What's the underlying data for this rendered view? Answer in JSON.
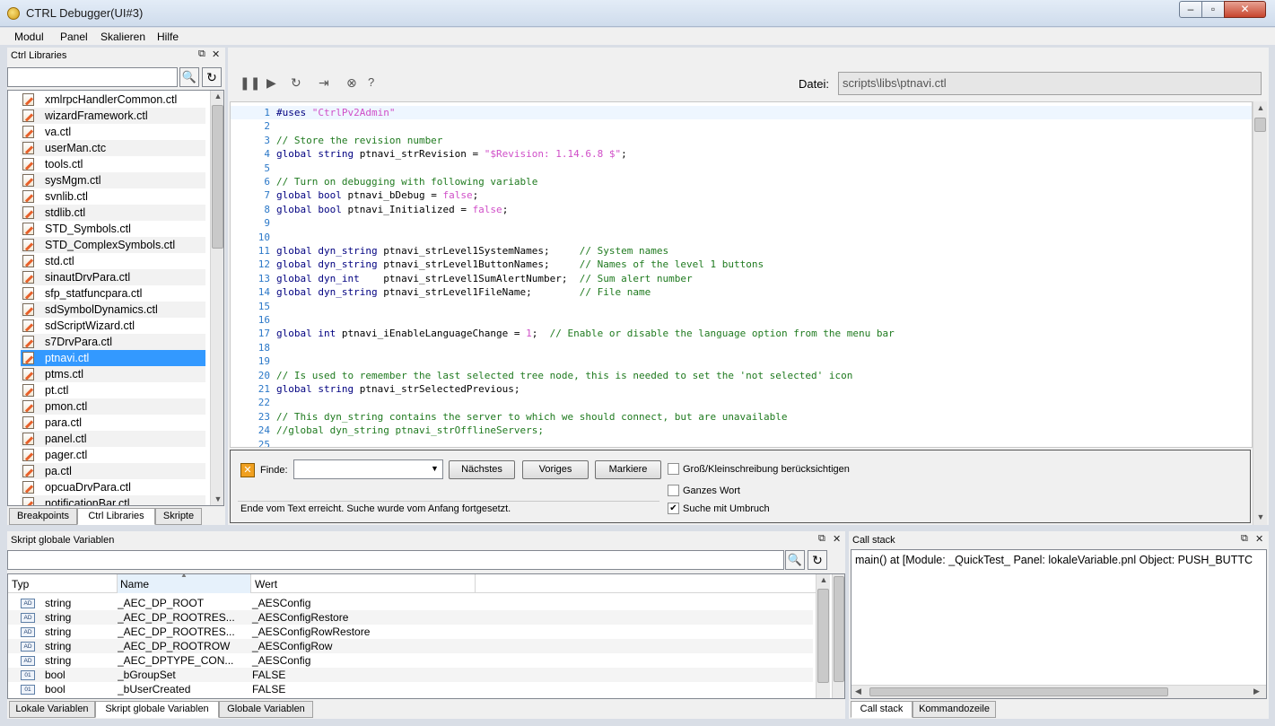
{
  "window": {
    "title": "CTRL Debugger(UI#3)",
    "min": "–",
    "max": "▫",
    "close": "✕"
  },
  "menu": [
    "Modul",
    "Panel",
    "Skalieren",
    "Hilfe"
  ],
  "libs_panel": {
    "title": "Ctrl Libraries",
    "search_placeholder": "",
    "items": [
      "xmlrpcHandlerCommon.ctl",
      "wizardFramework.ctl",
      "va.ctl",
      "userMan.ctc",
      "tools.ctl",
      "sysMgm.ctl",
      "svnlib.ctl",
      "stdlib.ctl",
      "STD_Symbols.ctl",
      "STD_ComplexSymbols.ctl",
      "std.ctl",
      "sinautDrvPara.ctl",
      "sfp_statfuncpara.ctl",
      "sdSymbolDynamics.ctl",
      "sdScriptWizard.ctl",
      "s7DrvPara.ctl",
      "ptnavi.ctl",
      "ptms.ctl",
      "pt.ctl",
      "pmon.ctl",
      "para.ctl",
      "panel.ctl",
      "pager.ctl",
      "pa.ctl",
      "opcuaDrvPara.ctl",
      "notificationBar.ctl"
    ],
    "selected_index": 16,
    "tabs": [
      "Breakpoints",
      "Ctrl Libraries",
      "Skripte"
    ],
    "active_tab": 1
  },
  "toolbar": {
    "file_label": "Datei:",
    "file_path": "scripts\\libs\\ptnavi.ctl",
    "help": "?"
  },
  "code": [
    {
      "n": "1",
      "t": [
        [
          "kw",
          "#uses "
        ],
        [
          "str",
          "\"CtrlPv2Admin\""
        ]
      ]
    },
    {
      "n": "2",
      "t": []
    },
    {
      "n": "3",
      "t": [
        [
          "cmt",
          "// Store the revision number"
        ]
      ]
    },
    {
      "n": "4",
      "t": [
        [
          "kw",
          "global string "
        ],
        [
          "",
          "ptnavi_strRevision = "
        ],
        [
          "str",
          "\"$Revision: 1.14.6.8 $\""
        ],
        [
          "",
          ";"
        ]
      ]
    },
    {
      "n": "5",
      "t": []
    },
    {
      "n": "6",
      "t": [
        [
          "cmt",
          "// Turn on debugging with following variable"
        ]
      ]
    },
    {
      "n": "7",
      "t": [
        [
          "kw",
          "global bool "
        ],
        [
          "",
          "ptnavi_bDebug = "
        ],
        [
          "fls",
          "false"
        ],
        [
          "",
          ";"
        ]
      ]
    },
    {
      "n": "8",
      "t": [
        [
          "kw",
          "global bool "
        ],
        [
          "",
          "ptnavi_Initialized = "
        ],
        [
          "fls",
          "false"
        ],
        [
          "",
          ";"
        ]
      ]
    },
    {
      "n": "9",
      "t": []
    },
    {
      "n": "10",
      "t": []
    },
    {
      "n": "11",
      "t": [
        [
          "kw",
          "global dyn_string "
        ],
        [
          "",
          "ptnavi_strLevel1SystemNames;     "
        ],
        [
          "cmt",
          "// System names"
        ]
      ]
    },
    {
      "n": "12",
      "t": [
        [
          "kw",
          "global dyn_string "
        ],
        [
          "",
          "ptnavi_strLevel1ButtonNames;     "
        ],
        [
          "cmt",
          "// Names of the level 1 buttons"
        ]
      ]
    },
    {
      "n": "13",
      "t": [
        [
          "kw",
          "global dyn_int    "
        ],
        [
          "",
          "ptnavi_strLevel1SumAlertNumber;  "
        ],
        [
          "cmt",
          "// Sum alert number"
        ]
      ]
    },
    {
      "n": "14",
      "t": [
        [
          "kw",
          "global dyn_string "
        ],
        [
          "",
          "ptnavi_strLevel1FileName;        "
        ],
        [
          "cmt",
          "// File name"
        ]
      ]
    },
    {
      "n": "15",
      "t": []
    },
    {
      "n": "16",
      "t": []
    },
    {
      "n": "17",
      "t": [
        [
          "kw",
          "global int "
        ],
        [
          "",
          "ptnavi_iEnableLanguageChange = "
        ],
        [
          "str",
          "1"
        ],
        [
          "",
          ";  "
        ],
        [
          "cmt",
          "// Enable or disable the language option from the menu bar"
        ]
      ]
    },
    {
      "n": "18",
      "t": []
    },
    {
      "n": "19",
      "t": []
    },
    {
      "n": "20",
      "t": [
        [
          "cmt",
          "// Is used to remember the last selected tree node, this is needed to set the 'not selected' icon"
        ]
      ]
    },
    {
      "n": "21",
      "t": [
        [
          "kw",
          "global string "
        ],
        [
          "",
          "ptnavi_strSelectedPrevious;"
        ]
      ]
    },
    {
      "n": "22",
      "t": []
    },
    {
      "n": "23",
      "t": [
        [
          "cmt",
          "// This dyn_string contains the server to which we should connect, but are unavailable"
        ]
      ]
    },
    {
      "n": "24",
      "t": [
        [
          "cmt",
          "//global dyn_string ptnavi_strOfflineServers;"
        ]
      ]
    },
    {
      "n": "25",
      "t": []
    }
  ],
  "find": {
    "label": "Finde:",
    "value": "",
    "next": "Nächstes",
    "prev": "Voriges",
    "mark": "Markiere",
    "case": "Groß/Kleinschreibung berücksichtigen",
    "whole": "Ganzes Wort",
    "wrap": "Suche mit Umbruch",
    "case_checked": false,
    "whole_checked": false,
    "wrap_checked": true,
    "status": "Ende vom Text erreicht. Suche wurde vom Anfang fortgesetzt."
  },
  "globals_panel": {
    "title": "Skript globale Variablen",
    "columns": [
      "Typ",
      "Name",
      "Wert"
    ],
    "rows": [
      {
        "icon": "AD",
        "type": "string",
        "name": "_AEC_DP_ROOT",
        "value": "_AESConfig"
      },
      {
        "icon": "AD",
        "type": "string",
        "name": "_AEC_DP_ROOTRES...",
        "value": "_AESConfigRestore"
      },
      {
        "icon": "AD",
        "type": "string",
        "name": "_AEC_DP_ROOTRES...",
        "value": "_AESConfigRowRestore"
      },
      {
        "icon": "AD",
        "type": "string",
        "name": "_AEC_DP_ROOTROW",
        "value": "_AESConfigRow"
      },
      {
        "icon": "AD",
        "type": "string",
        "name": "_AEC_DPTYPE_CON...",
        "value": "_AESConfig"
      },
      {
        "icon": "01",
        "type": "bool",
        "name": "_bGroupSet",
        "value": "FALSE"
      },
      {
        "icon": "01",
        "type": "bool",
        "name": "_bUserCreated",
        "value": "FALSE"
      }
    ],
    "tabs": [
      "Lokale Variablen",
      "Skript globale Variablen",
      "Globale Variablen"
    ],
    "active_tab": 1
  },
  "callstack_panel": {
    "title": "Call stack",
    "text": "main() at [Module: _QuickTest_ Panel: lokaleVariable.pnl Object: PUSH_BUTTC",
    "tabs": [
      "Call stack",
      "Kommandozeile"
    ],
    "active_tab": 0
  }
}
